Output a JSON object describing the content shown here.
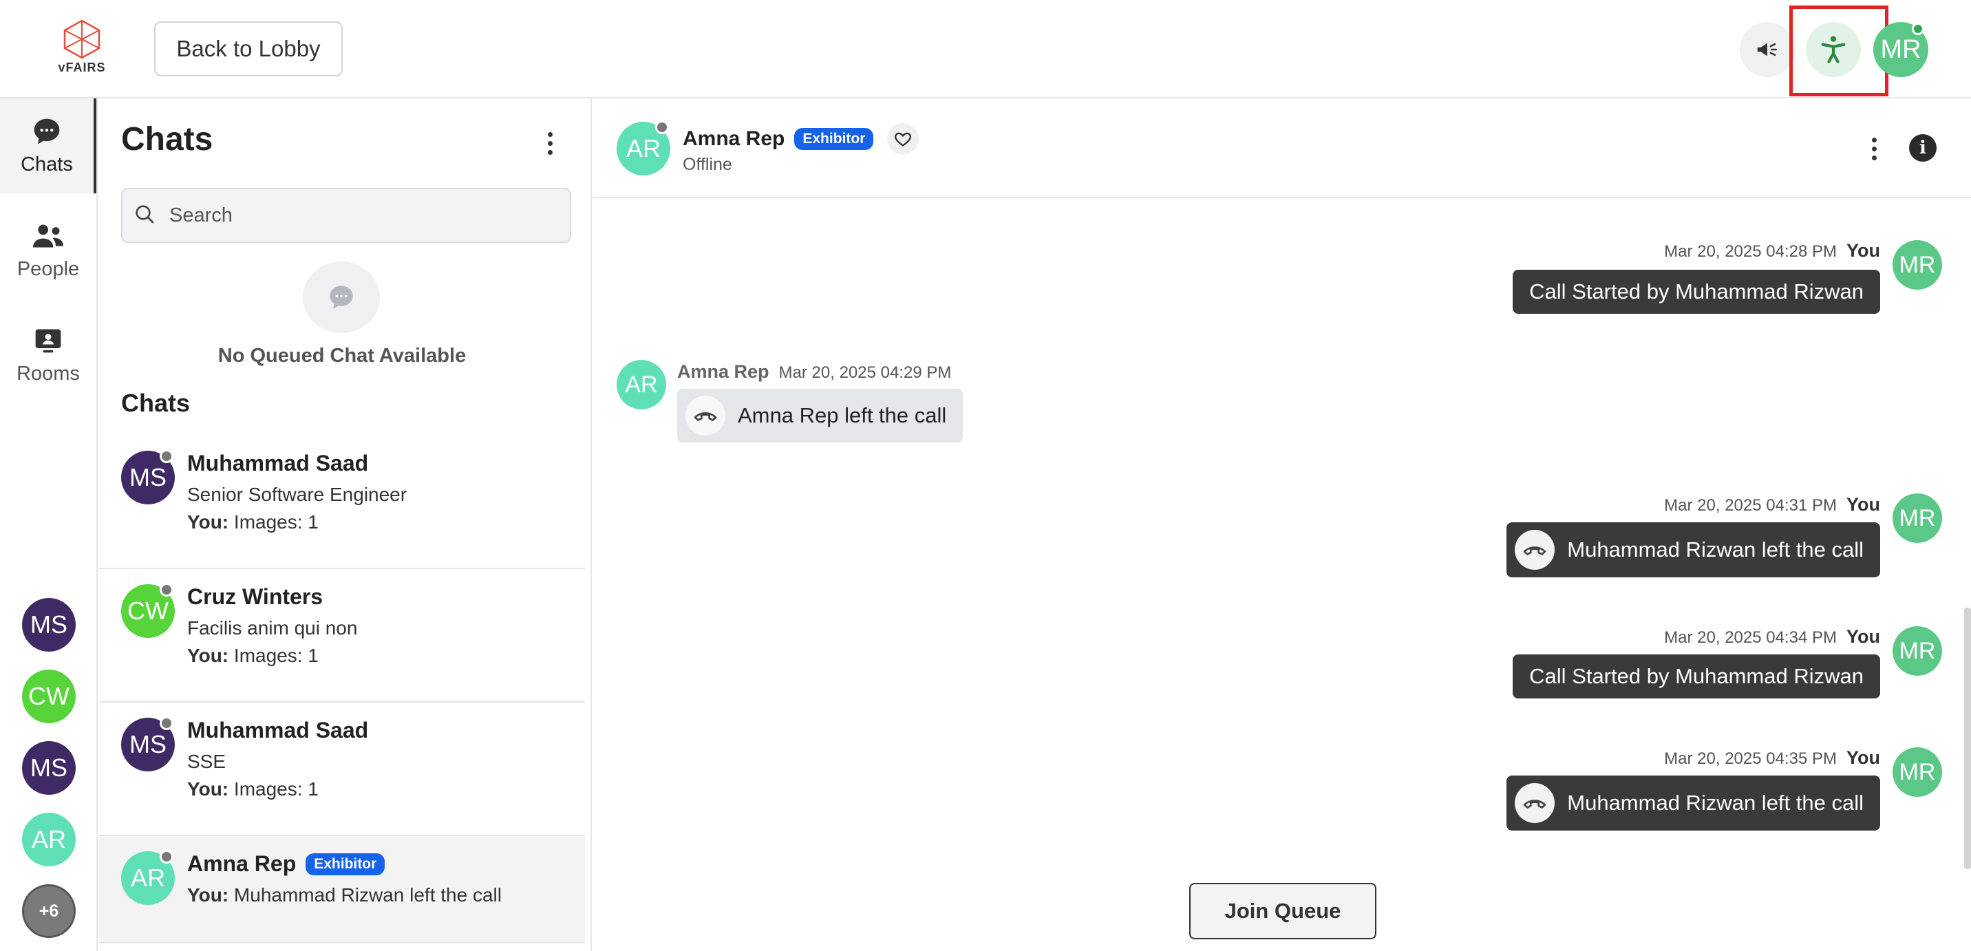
{
  "header": {
    "logo_text": "vFAIRS",
    "back_label": "Back to Lobby",
    "announcement_icon": "megaphone-icon",
    "accessibility_icon": "accessibility-icon",
    "user_initials": "MR"
  },
  "nav": {
    "items": [
      {
        "label": "Chats",
        "icon": "chat-bubble-icon"
      },
      {
        "label": "People",
        "icon": "people-icon"
      },
      {
        "label": "Rooms",
        "icon": "rooms-icon"
      }
    ],
    "recent": [
      {
        "initials": "MS",
        "color": "#3f2a66"
      },
      {
        "initials": "CW",
        "color": "#56d43a"
      },
      {
        "initials": "MS",
        "color": "#3f2a66"
      },
      {
        "initials": "AR",
        "color": "#5fdfb6"
      }
    ],
    "more_count": "+6"
  },
  "chats_panel": {
    "title": "Chats",
    "search_placeholder": "Search",
    "no_queue_text": "No Queued Chat Available",
    "section_title": "Chats",
    "rows": [
      {
        "initials": "MS",
        "color": "#3f2a66",
        "name": "Muhammad Saad",
        "subtitle": "Senior Software Engineer",
        "last_prefix": "You:",
        "last_message": "Images: 1"
      },
      {
        "initials": "CW",
        "color": "#56d43a",
        "name": "Cruz Winters",
        "subtitle": "Facilis anim qui non",
        "last_prefix": "You:",
        "last_message": "Images: 1"
      },
      {
        "initials": "MS",
        "color": "#3f2a66",
        "name": "Muhammad Saad",
        "subtitle": "SSE",
        "last_prefix": "You:",
        "last_message": "Images: 1"
      },
      {
        "initials": "AR",
        "color": "#5fdfb6",
        "name": "Amna Rep",
        "badge": "Exhibitor",
        "last_prefix": "You:",
        "last_message": "Muhammad Rizwan left the call"
      }
    ]
  },
  "conversation": {
    "contact_initials": "AR",
    "contact_name": "Amna Rep",
    "contact_badge": "Exhibitor",
    "contact_status": "Offline",
    "info_glyph": "i",
    "messages": [
      {
        "side": "right",
        "sender": "You",
        "initials": "MR",
        "timestamp": "Mar 20, 2025 04:28 PM",
        "text": "Call Started by Muhammad Rizwan",
        "call_icon": false
      },
      {
        "side": "left",
        "sender": "Amna Rep",
        "initials": "AR",
        "timestamp": "Mar 20, 2025 04:29 PM",
        "text": "Amna Rep left the call",
        "call_icon": true
      },
      {
        "side": "right",
        "sender": "You",
        "initials": "MR",
        "timestamp": "Mar 20, 2025 04:31 PM",
        "text": "Muhammad Rizwan left the call",
        "call_icon": true
      },
      {
        "side": "right",
        "sender": "You",
        "initials": "MR",
        "timestamp": "Mar 20, 2025 04:34 PM",
        "text": "Call Started by Muhammad Rizwan",
        "call_icon": false
      },
      {
        "side": "right",
        "sender": "You",
        "initials": "MR",
        "timestamp": "Mar 20, 2025 04:35 PM",
        "text": "Muhammad Rizwan left the call",
        "call_icon": true
      }
    ],
    "join_queue_label": "Join Queue"
  }
}
